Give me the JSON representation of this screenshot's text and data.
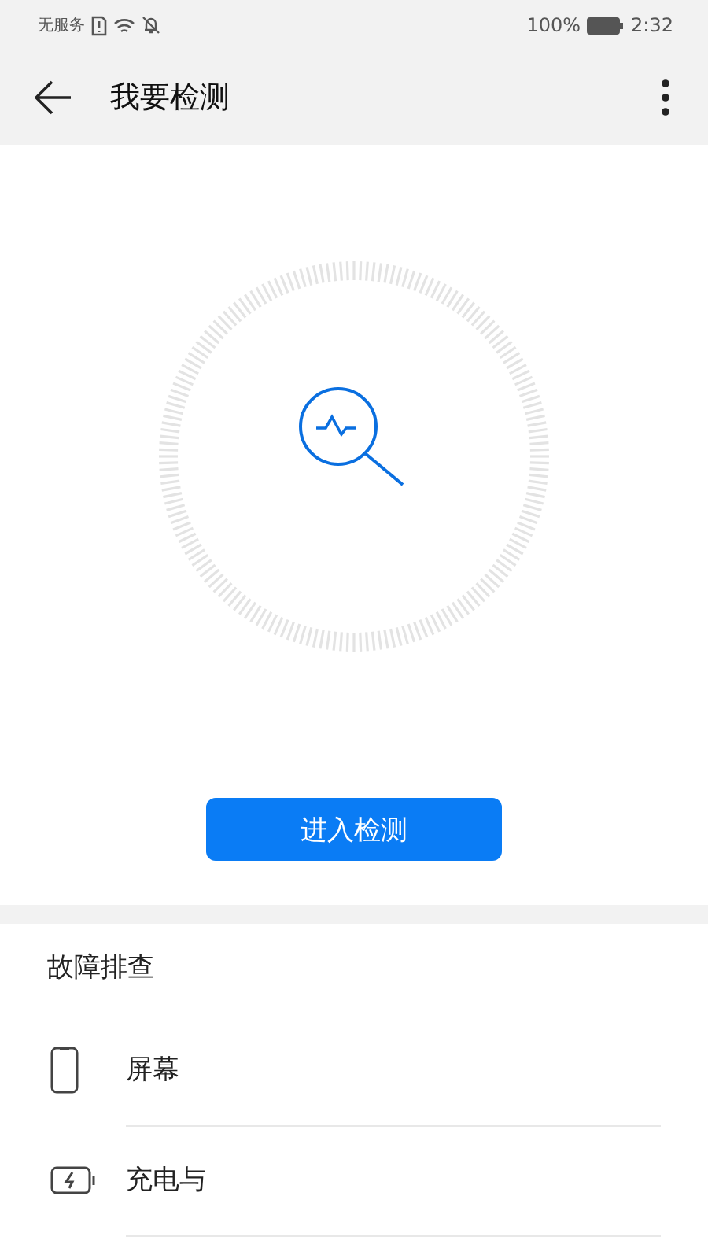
{
  "status_bar": {
    "carrier": "无服务",
    "battery_percent": "100%",
    "time": "2:32"
  },
  "header": {
    "title": "我要检测"
  },
  "detect": {
    "button": "进入检测"
  },
  "troubleshooting": {
    "title": "故障排查",
    "items": [
      {
        "kind": "screen",
        "label": "屏幕"
      },
      {
        "kind": "battery",
        "label": "充电与"
      }
    ]
  }
}
